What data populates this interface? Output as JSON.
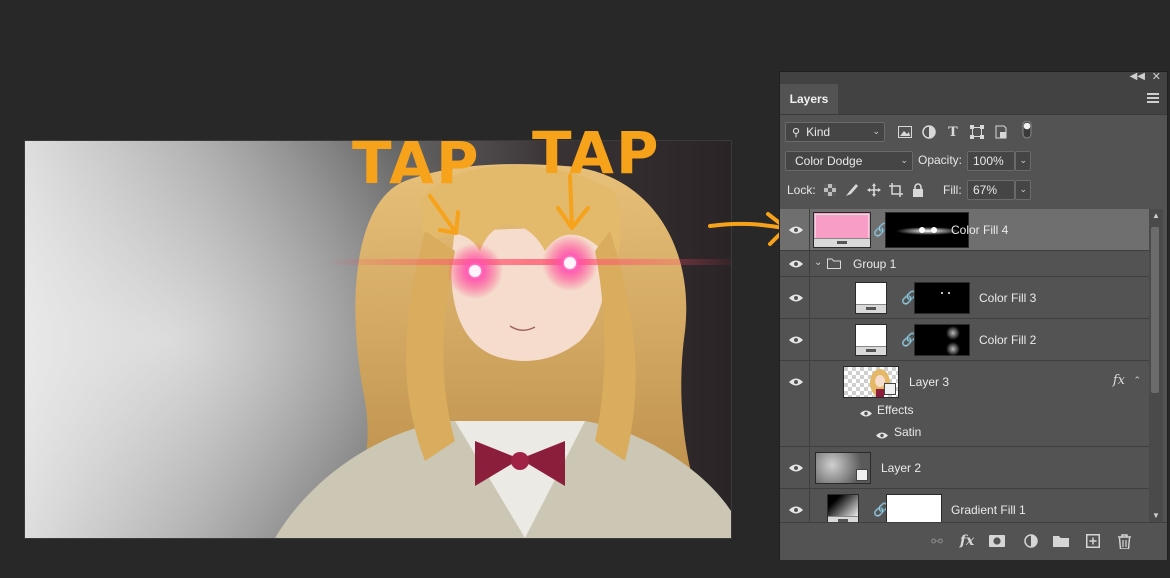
{
  "annotations": {
    "text_left": "TAP",
    "text_right": "TAP",
    "accent_color": "#f7a21b"
  },
  "panel": {
    "tab_title": "Layers",
    "collapse_icon": "double-chevron-left",
    "close_icon": "close",
    "filter_kind_label": "Kind",
    "blend_mode": "Color Dodge",
    "opacity_label": "Opacity:",
    "opacity_value": "100%",
    "lock_label": "Lock:",
    "fill_label": "Fill:",
    "fill_value": "67%"
  },
  "layers": [
    {
      "name": "Color Fill 4",
      "selected": true
    },
    {
      "name": "Group 1"
    },
    {
      "name": "Color Fill 3"
    },
    {
      "name": "Color Fill 2"
    },
    {
      "name": "Layer 3",
      "effects_label": "Effects",
      "effect_name": "Satin"
    },
    {
      "name": "Layer 2"
    },
    {
      "name": "Gradient Fill 1"
    }
  ],
  "colors": {
    "fill4_swatch": "#f79dc6",
    "panel_bg": "#535353",
    "app_bg": "#282828"
  }
}
